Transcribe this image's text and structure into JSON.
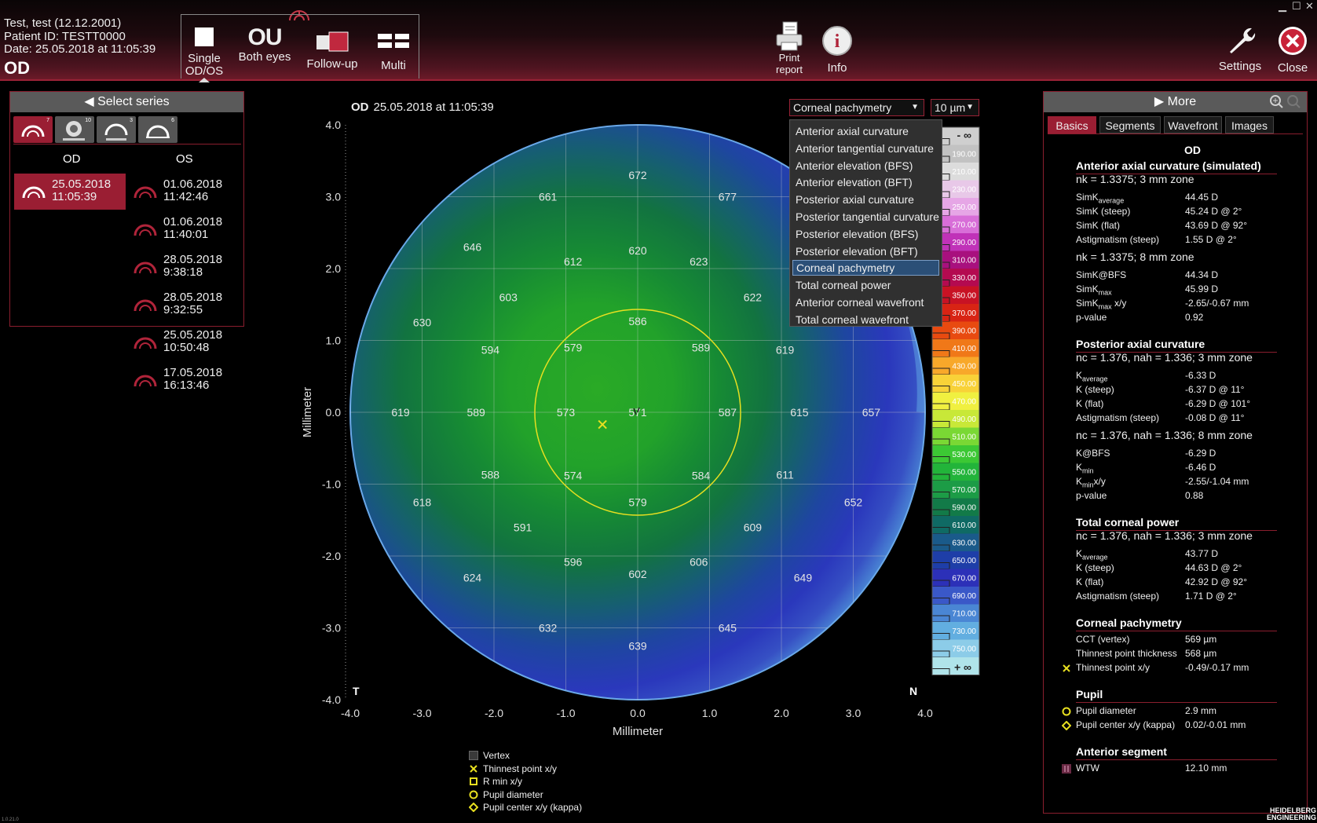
{
  "patient": {
    "name_line": "Test, test (12.12.2001)",
    "id_line": "Patient ID: TESTT0000",
    "date_line": "Date: 25.05.2018 at 11:05:39",
    "eye": "OD"
  },
  "header": {
    "modes": [
      {
        "label1": "Single",
        "label2": "OD/OS",
        "icon": "square-icon"
      },
      {
        "label1": "Both eyes",
        "label2": "",
        "icon": "ou-icon"
      },
      {
        "label1": "Follow-up",
        "label2": "",
        "icon": "follow-up-icon"
      },
      {
        "label1": "Multi",
        "label2": "",
        "icon": "multi-icon"
      }
    ],
    "ou_text": "OU",
    "print_label1": "Print",
    "print_label2": "report",
    "info_label": "Info",
    "settings_label": "Settings",
    "close_label": "Close"
  },
  "series_panel": {
    "title": "Select series",
    "tab_counts": [
      "7",
      "10",
      "3",
      "6"
    ],
    "col_od": "OD",
    "col_os": "OS",
    "od_items": [
      {
        "date": "25.05.2018",
        "time": "11:05:39"
      }
    ],
    "os_items": [
      {
        "date": "01.06.2018",
        "time": "11:42:46"
      },
      {
        "date": "01.06.2018",
        "time": "11:40:01"
      },
      {
        "date": "28.05.2018",
        "time": "9:38:18"
      },
      {
        "date": "28.05.2018",
        "time": "9:32:55"
      },
      {
        "date": "25.05.2018",
        "time": "10:50:48"
      },
      {
        "date": "17.05.2018",
        "time": "16:13:46"
      }
    ]
  },
  "map": {
    "eye": "OD",
    "title": "25.05.2018 at 11:05:39",
    "map_type": "Corneal pachymetry",
    "step": "10 µm",
    "dropdown_options": [
      "Anterior axial curvature",
      "Anterior tangential curvature",
      "Anterior elevation (BFS)",
      "Anterior elevation (BFT)",
      "Posterior axial curvature",
      "Posterior tangential curvature",
      "Posterior elevation (BFS)",
      "Posterior elevation (BFT)",
      "Corneal pachymetry",
      "Total corneal power",
      "Anterior corneal wavefront",
      "Total corneal wavefront"
    ],
    "selected_option": "Corneal pachymetry",
    "temporal": "T",
    "nasal": "N",
    "scale_min": "- ∞",
    "scale_max": "+ ∞",
    "scale_values": [
      "190.00",
      "210.00",
      "230.00",
      "250.00",
      "270.00",
      "290.00",
      "310.00",
      "330.00",
      "350.00",
      "370.00",
      "390.00",
      "410.00",
      "430.00",
      "450.00",
      "470.00",
      "490.00",
      "510.00",
      "530.00",
      "550.00",
      "570.00",
      "590.00",
      "610.00",
      "630.00",
      "650.00",
      "670.00",
      "690.00",
      "710.00",
      "730.00",
      "750.00"
    ],
    "scale_colors": [
      "#cfcfcf",
      "#c2c2c2",
      "#dcdcdc",
      "#e8c8e8",
      "#e6a6e6",
      "#d86ed8",
      "#c032b8",
      "#a8107e",
      "#b40a50",
      "#c81224",
      "#d82414",
      "#e84a10",
      "#f07818",
      "#f8a82a",
      "#f8d238",
      "#f0f040",
      "#c8e838",
      "#7ad834",
      "#3cc834",
      "#22b43a",
      "#1c9c46",
      "#127a48",
      "#0f6a64",
      "#1a5a8a",
      "#1e3ea8",
      "#2c30b8",
      "#3a58c8",
      "#4a86d4",
      "#62aee0",
      "#8ccce8",
      "#b0e4ea"
    ],
    "legend": [
      {
        "label": "Vertex",
        "icon": "vertex-icon"
      },
      {
        "label": "Thinnest point x/y",
        "icon": "cross-icon"
      },
      {
        "label": "R min x/y",
        "icon": "square-marker-icon"
      },
      {
        "label": "Pupil diameter",
        "icon": "circle-marker-icon"
      },
      {
        "label": "Pupil center x/y (kappa)",
        "icon": "diamond-marker-icon"
      }
    ]
  },
  "chart_data": {
    "type": "heatmap",
    "title": "25.05.2018 at 11:05:39",
    "xlabel": "Millimeter",
    "ylabel": "Millimeter",
    "xlim": [
      -4,
      4
    ],
    "ylim": [
      -4,
      4
    ],
    "grid": true,
    "ticks": [
      "-4.0",
      "-3.0",
      "-2.0",
      "-1.0",
      "0.0",
      "1.0",
      "2.0",
      "3.0",
      "4.0"
    ],
    "tick_labels_y": [
      "4.0",
      "3.0",
      "2.0",
      "1.0",
      "0.0",
      "-1.0",
      "-2.0",
      "-3.0",
      "-4.0"
    ],
    "pupil_diameter_mm": 2.9,
    "thinnest_point": [
      -0.49,
      -0.17
    ],
    "values": [
      {
        "x": 0.0,
        "y": 3.3,
        "v": 672
      },
      {
        "x": -1.25,
        "y": 3.0,
        "v": 661
      },
      {
        "x": 1.25,
        "y": 3.0,
        "v": 677
      },
      {
        "x": -2.3,
        "y": 2.3,
        "v": 646
      },
      {
        "x": 0.0,
        "y": 2.25,
        "v": 620
      },
      {
        "x": -0.9,
        "y": 2.1,
        "v": 612
      },
      {
        "x": 0.85,
        "y": 2.1,
        "v": 623
      },
      {
        "x": -1.8,
        "y": 1.6,
        "v": 603
      },
      {
        "x": 1.6,
        "y": 1.6,
        "v": 622
      },
      {
        "x": -3.0,
        "y": 1.25,
        "v": 630
      },
      {
        "x": 0.0,
        "y": 1.27,
        "v": 586
      },
      {
        "x": -2.05,
        "y": 0.87,
        "v": 594
      },
      {
        "x": -0.9,
        "y": 0.9,
        "v": 579
      },
      {
        "x": 0.88,
        "y": 0.9,
        "v": 589
      },
      {
        "x": 2.05,
        "y": 0.87,
        "v": 619
      },
      {
        "x": -3.3,
        "y": 0.0,
        "v": 619
      },
      {
        "x": -2.25,
        "y": 0.0,
        "v": 589
      },
      {
        "x": -1.0,
        "y": 0.0,
        "v": 573
      },
      {
        "x": 0.0,
        "y": 0.0,
        "v": 571
      },
      {
        "x": 1.25,
        "y": 0.0,
        "v": 587
      },
      {
        "x": 2.25,
        "y": 0.0,
        "v": 615
      },
      {
        "x": 3.25,
        "y": 0.0,
        "v": 657
      },
      {
        "x": -2.05,
        "y": -0.87,
        "v": 588
      },
      {
        "x": -0.9,
        "y": -0.88,
        "v": 574
      },
      {
        "x": 0.88,
        "y": -0.88,
        "v": 584
      },
      {
        "x": 2.05,
        "y": -0.87,
        "v": 611
      },
      {
        "x": -3.0,
        "y": -1.25,
        "v": 618
      },
      {
        "x": 0.0,
        "y": -1.25,
        "v": 579
      },
      {
        "x": 3.0,
        "y": -1.25,
        "v": 652
      },
      {
        "x": -1.6,
        "y": -1.6,
        "v": 591
      },
      {
        "x": 1.6,
        "y": -1.6,
        "v": 609
      },
      {
        "x": -0.9,
        "y": -2.08,
        "v": 596
      },
      {
        "x": 0.85,
        "y": -2.08,
        "v": 606
      },
      {
        "x": 0.0,
        "y": -2.25,
        "v": 602
      },
      {
        "x": -2.3,
        "y": -2.3,
        "v": 624
      },
      {
        "x": 2.3,
        "y": -2.3,
        "v": 649
      },
      {
        "x": -1.25,
        "y": -3.0,
        "v": 632
      },
      {
        "x": 1.25,
        "y": -3.0,
        "v": 645
      },
      {
        "x": 0.0,
        "y": -3.25,
        "v": 639
      }
    ]
  },
  "right_panel": {
    "title": "More",
    "tabs": [
      "Basics",
      "Segments",
      "Wavefront",
      "Images"
    ],
    "eye": "OD",
    "sections": [
      {
        "h": "Anterior axial curvature (simulated)",
        "rows": [
          {
            "sub": "nk = 1.3375; 3 mm zone"
          },
          {
            "k": "SimK",
            "ks": "average",
            "v": "44.45 D"
          },
          {
            "k": "SimK (steep)",
            "v": "45.24 D @ 2°"
          },
          {
            "k": "SimK (flat)",
            "v": "43.69 D @ 92°"
          },
          {
            "k": "Astigmatism (steep)",
            "v": "1.55 D @ 2°"
          },
          {
            "sub": "nk = 1.3375; 8 mm zone"
          },
          {
            "k": "SimK@BFS",
            "v": "44.34 D"
          },
          {
            "k": "SimK",
            "ks": "max",
            "v": "45.99 D"
          },
          {
            "k": "SimK",
            "ks": "max",
            "kt": " x/y",
            "v": "-2.65/-0.67 mm"
          },
          {
            "k": "p-value",
            "v": "0.92"
          }
        ]
      },
      {
        "h": "Posterior axial curvature",
        "rows": [
          {
            "sub": "nc = 1.376, nah = 1.336; 3 mm zone"
          },
          {
            "k": "K",
            "ks": "average",
            "v": "-6.33 D"
          },
          {
            "k": "K (steep)",
            "v": "-6.37 D @ 11°"
          },
          {
            "k": "K (flat)",
            "v": "-6.29 D @ 101°"
          },
          {
            "k": "Astigmatism (steep)",
            "v": "-0.08 D @ 11°"
          },
          {
            "sub": "nc = 1.376, nah = 1.336; 8 mm zone"
          },
          {
            "k": "K@BFS",
            "v": "-6.29 D"
          },
          {
            "k": "K",
            "ks": "min",
            "v": "-6.46 D"
          },
          {
            "k": "K",
            "ks": "min",
            "kt": "x/y",
            "v": "-2.55/-1.04 mm"
          },
          {
            "k": "p-value",
            "v": "0.88"
          }
        ]
      },
      {
        "h": "Total corneal power",
        "rows": [
          {
            "sub": "nc = 1.376, nah = 1.336; 3 mm zone"
          },
          {
            "k": "K",
            "ks": "average",
            "v": "43.77 D"
          },
          {
            "k": "K (steep)",
            "v": "44.63 D @ 2°"
          },
          {
            "k": "K (flat)",
            "v": "42.92 D @ 92°"
          },
          {
            "k": "Astigmatism (steep)",
            "v": "1.71 D @ 2°"
          }
        ]
      },
      {
        "h": "Corneal pachymetry",
        "rows": [
          {
            "k": "CCT (vertex)",
            "v": "569 µm"
          },
          {
            "k": "Thinnest point thickness",
            "v": "568 µm"
          },
          {
            "k": "Thinnest point x/y",
            "v": "-0.49/-0.17 mm",
            "icon": "cross-icon"
          }
        ]
      },
      {
        "h": "Pupil",
        "rows": [
          {
            "k": "Pupil diameter",
            "v": "2.9 mm",
            "icon": "circle-marker-icon"
          },
          {
            "k": "Pupil center x/y (kappa)",
            "v": "0.02/-0.01 mm",
            "icon": "diamond-marker-icon"
          }
        ]
      },
      {
        "h": "Anterior segment",
        "rows": [
          {
            "k": "WTW",
            "v": "12.10 mm",
            "icon": "wtw-icon"
          }
        ]
      }
    ]
  },
  "footer": {
    "version": "1.0.21.0",
    "brand1": "HEIDELBERG",
    "brand2": "ENGINEERING"
  },
  "colors": {
    "accent": "#9a1e33",
    "marker": "#e8e020"
  }
}
